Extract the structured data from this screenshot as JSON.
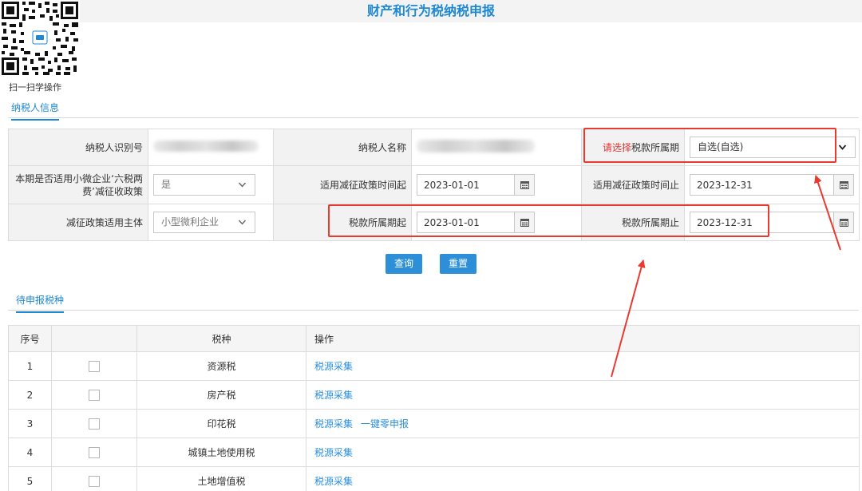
{
  "header": {
    "title": "财产和行为税纳税申报"
  },
  "qr": {
    "caption": "扫一扫学操作"
  },
  "sections": {
    "taxpayer_info": "纳税人信息",
    "pending_taxes": "待申报税种"
  },
  "form": {
    "taxpayer_id_label": "纳税人识别号",
    "taxpayer_name_label": "纳税人名称",
    "period_required_prefix": "请选择",
    "period_label": "税款所属期",
    "period_select_value": "自选(自选)",
    "small_micro_label": "本期是否适用小微企业‘六税两费’减征收政策",
    "small_micro_value": "是",
    "relief_start_label": "适用减征政策时间起",
    "relief_start_value": "2023-01-01",
    "relief_end_label": "适用减征政策时间止",
    "relief_end_value": "2023-12-31",
    "relief_subject_label": "减征政策适用主体",
    "relief_subject_value": "小型微利企业",
    "period_start_label": "税款所属期起",
    "period_start_value": "2023-01-01",
    "period_end_label": "税款所属期止",
    "period_end_value": "2023-12-31"
  },
  "buttons": {
    "query": "查询",
    "reset": "重置"
  },
  "table": {
    "headers": {
      "seq": "序号",
      "tax": "税种",
      "action": "操作"
    },
    "rows": [
      {
        "seq": "1",
        "tax": "资源税",
        "actions": [
          "税源采集"
        ]
      },
      {
        "seq": "2",
        "tax": "房产税",
        "actions": [
          "税源采集"
        ]
      },
      {
        "seq": "3",
        "tax": "印花税",
        "actions": [
          "税源采集",
          "一键零申报"
        ]
      },
      {
        "seq": "4",
        "tax": "城镇土地使用税",
        "actions": [
          "税源采集"
        ]
      },
      {
        "seq": "5",
        "tax": "土地增值税",
        "actions": [
          "税源采集"
        ]
      }
    ]
  },
  "colors": {
    "accent": "#1e88d2",
    "button": "#2c8fd8",
    "annotation": "#e93a30",
    "required": "#e63333"
  },
  "icons": {
    "calendar": "calendar-icon",
    "dropdown": "chevron-down-icon",
    "checkbox": "checkbox-icon"
  }
}
